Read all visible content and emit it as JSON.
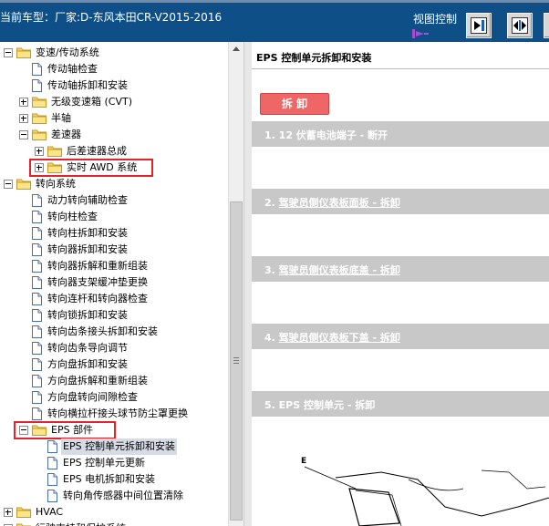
{
  "header": {
    "vehicle_label": "当前车型：厂家:D-东风本田CR-V2015-2016",
    "view_control_label": "视图控制",
    "buttons": [
      "next-panel-icon",
      "split-view-icon",
      "extra-icon"
    ]
  },
  "tree": {
    "items": [
      {
        "label": "变速/传动系统",
        "level": 0,
        "type": "folder",
        "expander": "minus"
      },
      {
        "label": "传动轴检查",
        "level": 1,
        "type": "doc"
      },
      {
        "label": "传动轴拆卸和安装",
        "level": 1,
        "type": "doc"
      },
      {
        "label": "无级变速箱 (CVT)",
        "level": 1,
        "type": "folder",
        "expander": "plus"
      },
      {
        "label": "半轴",
        "level": 1,
        "type": "folder",
        "expander": "plus"
      },
      {
        "label": "差速器",
        "level": 1,
        "type": "folder",
        "expander": "minus"
      },
      {
        "label": "后差速器总成",
        "level": 2,
        "type": "folder",
        "expander": "plus"
      },
      {
        "label": "实时 AWD 系统",
        "level": 2,
        "type": "folder",
        "expander": "plus",
        "highlight": true
      },
      {
        "label": "转向系统",
        "level": 0,
        "type": "folder",
        "expander": "minus"
      },
      {
        "label": "动力转向辅助检查",
        "level": 1,
        "type": "doc"
      },
      {
        "label": "转向柱检查",
        "level": 1,
        "type": "doc"
      },
      {
        "label": "转向柱拆卸和安装",
        "level": 1,
        "type": "doc"
      },
      {
        "label": "转向器拆卸和安装",
        "level": 1,
        "type": "doc"
      },
      {
        "label": "转向器拆解和重新组装",
        "level": 1,
        "type": "doc"
      },
      {
        "label": "转向器支架缓冲垫更换",
        "level": 1,
        "type": "doc"
      },
      {
        "label": "转向连杆和转向器检查",
        "level": 1,
        "type": "doc"
      },
      {
        "label": "转向锁拆卸和安装",
        "level": 1,
        "type": "doc"
      },
      {
        "label": "转向齿条接头拆卸和安装",
        "level": 1,
        "type": "doc"
      },
      {
        "label": "转向齿条导向调节",
        "level": 1,
        "type": "doc"
      },
      {
        "label": "方向盘拆卸和安装",
        "level": 1,
        "type": "doc"
      },
      {
        "label": "方向盘拆解和重新组装",
        "level": 1,
        "type": "doc"
      },
      {
        "label": "方向盘转向间隙检查",
        "level": 1,
        "type": "doc"
      },
      {
        "label": "转向横拉杆接头球节防尘罩更换",
        "level": 1,
        "type": "doc"
      },
      {
        "label": "EPS 部件",
        "level": 1,
        "type": "folder",
        "expander": "minus",
        "highlight": true
      },
      {
        "label": "EPS 控制单元拆卸和安装",
        "level": 2,
        "type": "doc",
        "selected": true
      },
      {
        "label": "EPS 控制单元更新",
        "level": 2,
        "type": "doc"
      },
      {
        "label": "EPS 电机拆卸和安装",
        "level": 2,
        "type": "doc"
      },
      {
        "label": "转向角传感器中间位置清除",
        "level": 2,
        "type": "doc"
      },
      {
        "label": "HVAC",
        "level": 0,
        "type": "folder",
        "expander": "plus"
      },
      {
        "label": "行驶支持和保护系统",
        "level": 0,
        "type": "folder",
        "expander": "plus"
      }
    ]
  },
  "content": {
    "title": "EPS 控制单元拆卸和安装",
    "disassemble_button": "拆 卸",
    "steps": [
      {
        "num": "1. ",
        "text": "12 伏蓄电池端子 - 断开"
      },
      {
        "num": "2. ",
        "text": "驾驶员侧仪表板面板 - 拆卸"
      },
      {
        "num": "3. ",
        "text": "驾驶员侧仪表板底盖 - 拆卸"
      },
      {
        "num": "4. ",
        "text": "驾驶员侧仪表板下盖 - 拆卸"
      },
      {
        "num": "5. ",
        "text": "EPS 控制单元 - 拆卸"
      }
    ],
    "figure_label": "E"
  },
  "colors": {
    "header_bg": "#0d4f86",
    "step_bg": "#c8c8c8",
    "button_bg": "#e66666",
    "highlight_border": "#e0242b",
    "selected_bg": "#d6dbe6"
  }
}
